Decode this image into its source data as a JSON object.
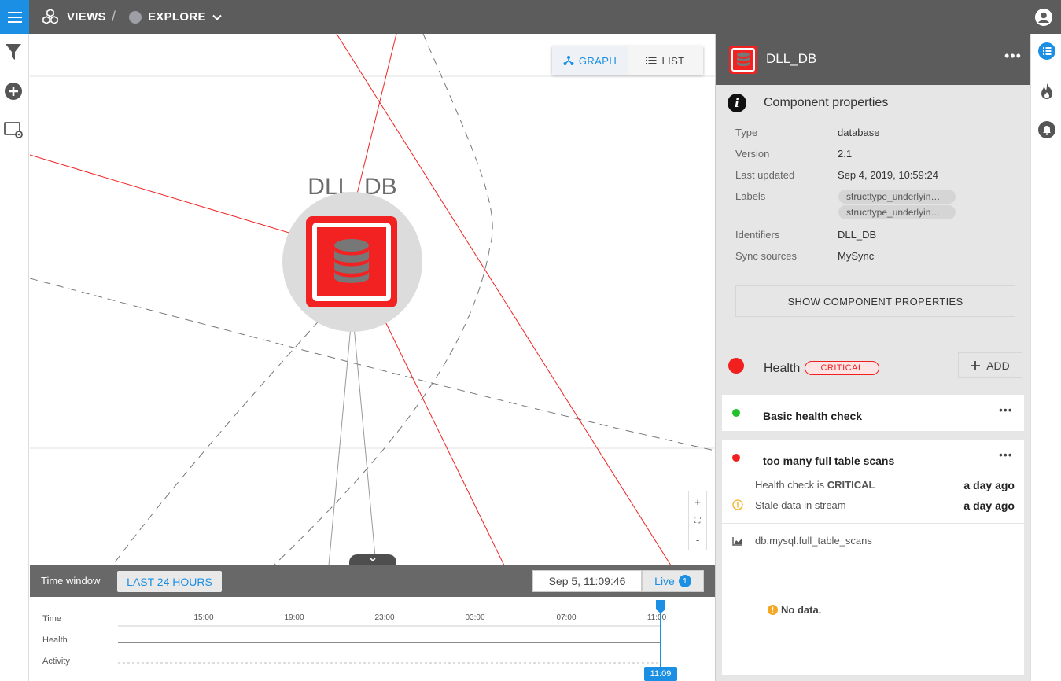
{
  "topbar": {
    "views_label": "VIEWS",
    "separator": "/",
    "explore_label": "EXPLORE"
  },
  "left_toolbar": {
    "icons": [
      "filter-icon",
      "add-circle-icon",
      "view-settings-icon"
    ]
  },
  "graph": {
    "view_toggle": {
      "graph_label": "GRAPH",
      "list_label": "LIST",
      "active": "GRAPH"
    },
    "node": {
      "name": "DLL_DB",
      "health_color": "#f22222"
    },
    "zoom": {
      "in": "+",
      "fit": "⛶",
      "out": "-"
    }
  },
  "time_window": {
    "label": "Time window",
    "range_button": "LAST 24 HOURS",
    "current_time": "Sep 5, 11:09:46",
    "live_label": "Live",
    "live_count": "1"
  },
  "timeline": {
    "row_labels": [
      "Time",
      "Health",
      "Activity"
    ],
    "ticks": [
      "15:00",
      "19:00",
      "23:00",
      "03:00",
      "07:00",
      "11:00"
    ],
    "now_label": "11:09"
  },
  "panel": {
    "title": "DLL_DB",
    "component_properties_title": "Component properties",
    "properties": [
      {
        "key": "Type",
        "value": "database"
      },
      {
        "key": "Version",
        "value": "2.1"
      },
      {
        "key": "Last updated",
        "value": "Sep 4, 2019, 10:59:24"
      },
      {
        "key": "Labels",
        "value": ""
      },
      {
        "key": "Identifiers",
        "value": "DLL_DB"
      },
      {
        "key": "Sync sources",
        "value": "MySync"
      }
    ],
    "labels": [
      "structtype_underlyin…",
      "structtype_underlyin…"
    ],
    "show_properties_button": "SHOW COMPONENT PROPERTIES",
    "health_title": "Health",
    "health_state": "CRITICAL",
    "add_button": "ADD",
    "checks": [
      {
        "name": "Basic health check",
        "color": "#22c02a"
      },
      {
        "name": "too many full table scans",
        "color": "#f21f1f",
        "status_prefix": "Health check is ",
        "status_value": "CRITICAL",
        "status_time": "a day ago",
        "stale_link": "Stale data in stream",
        "stale_time": "a day ago",
        "metric": "db.mysql.full_table_scans",
        "no_data": "No data."
      }
    ]
  },
  "right_toolbar": {
    "icons": [
      "list-icon",
      "fire-icon",
      "bell-icon"
    ]
  },
  "colors": {
    "accent": "#1a8fe3",
    "critical": "#f21f1f",
    "clear": "#22c02a",
    "topbar": "#5c5c5c"
  }
}
